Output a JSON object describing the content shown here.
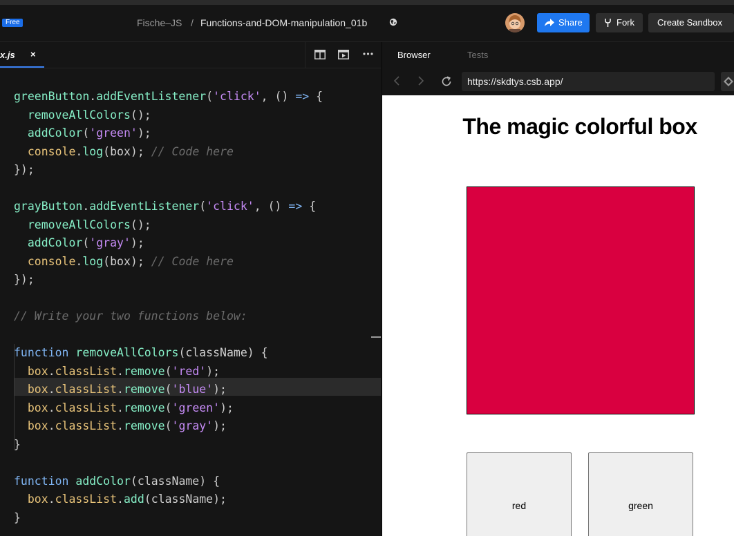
{
  "topbar": {
    "plan_badge": "Free",
    "owner": "Fische–JS",
    "separator": "/",
    "sandbox_name": "Functions-and-DOM-manipulation_01b",
    "share_label": "Share",
    "fork_label": "Fork",
    "create_label": "Create Sandbox"
  },
  "editor": {
    "active_tab": "x.js",
    "close_glyph": "×",
    "code_lines": [
      [
        [
          "fn",
          "greenButton"
        ],
        [
          "p",
          "."
        ],
        [
          "fn",
          "addEventListener"
        ],
        [
          "p",
          "("
        ],
        [
          "str",
          "'click'"
        ],
        [
          "p",
          ", () "
        ],
        [
          "kw",
          "=>"
        ],
        [
          "p",
          " {"
        ]
      ],
      [
        [
          "p",
          "  "
        ],
        [
          "fn",
          "removeAllColors"
        ],
        [
          "p",
          "();"
        ]
      ],
      [
        [
          "p",
          "  "
        ],
        [
          "fn",
          "addColor"
        ],
        [
          "p",
          "("
        ],
        [
          "str",
          "'green'"
        ],
        [
          "p",
          ");"
        ]
      ],
      [
        [
          "p",
          "  "
        ],
        [
          "pr",
          "console"
        ],
        [
          "p",
          "."
        ],
        [
          "fn",
          "log"
        ],
        [
          "p",
          "(box); "
        ],
        [
          "cm",
          "// Code here"
        ]
      ],
      [
        [
          "p",
          "});"
        ]
      ],
      [],
      [
        [
          "fn",
          "grayButton"
        ],
        [
          "p",
          "."
        ],
        [
          "fn",
          "addEventListener"
        ],
        [
          "p",
          "("
        ],
        [
          "str",
          "'click'"
        ],
        [
          "p",
          ", () "
        ],
        [
          "kw",
          "=>"
        ],
        [
          "p",
          " {"
        ]
      ],
      [
        [
          "p",
          "  "
        ],
        [
          "fn",
          "removeAllColors"
        ],
        [
          "p",
          "();"
        ]
      ],
      [
        [
          "p",
          "  "
        ],
        [
          "fn",
          "addColor"
        ],
        [
          "p",
          "("
        ],
        [
          "str",
          "'gray'"
        ],
        [
          "p",
          ");"
        ]
      ],
      [
        [
          "p",
          "  "
        ],
        [
          "pr",
          "console"
        ],
        [
          "p",
          "."
        ],
        [
          "fn",
          "log"
        ],
        [
          "p",
          "(box); "
        ],
        [
          "cm",
          "// Code here"
        ]
      ],
      [
        [
          "p",
          "});"
        ]
      ],
      [],
      [
        [
          "cm",
          "// Write your two functions below:"
        ]
      ],
      [],
      [
        [
          "kw",
          "function"
        ],
        [
          "p",
          " "
        ],
        [
          "fn",
          "removeAllColors"
        ],
        [
          "p",
          "(className) {"
        ]
      ],
      [
        [
          "p",
          "  "
        ],
        [
          "pr",
          "box"
        ],
        [
          "p",
          "."
        ],
        [
          "pr",
          "classList"
        ],
        [
          "p",
          "."
        ],
        [
          "fn",
          "remove"
        ],
        [
          "p",
          "("
        ],
        [
          "str",
          "'red'"
        ],
        [
          "p",
          ");"
        ]
      ],
      [
        [
          "p",
          "  "
        ],
        [
          "pr",
          "box"
        ],
        [
          "p",
          "."
        ],
        [
          "pr",
          "classList"
        ],
        [
          "p",
          "."
        ],
        [
          "fn",
          "remove"
        ],
        [
          "p",
          "("
        ],
        [
          "str",
          "'blue'"
        ],
        [
          "p",
          ");"
        ]
      ],
      [
        [
          "p",
          "  "
        ],
        [
          "pr",
          "box"
        ],
        [
          "p",
          "."
        ],
        [
          "pr",
          "classList"
        ],
        [
          "p",
          "."
        ],
        [
          "fn",
          "remove"
        ],
        [
          "p",
          "("
        ],
        [
          "str",
          "'green'"
        ],
        [
          "p",
          ");"
        ]
      ],
      [
        [
          "p",
          "  "
        ],
        [
          "pr",
          "box"
        ],
        [
          "p",
          "."
        ],
        [
          "pr",
          "classList"
        ],
        [
          "p",
          "."
        ],
        [
          "fn",
          "remove"
        ],
        [
          "p",
          "("
        ],
        [
          "str",
          "'gray'"
        ],
        [
          "p",
          ");"
        ]
      ],
      [
        [
          "p",
          "}"
        ]
      ],
      [],
      [
        [
          "kw",
          "function"
        ],
        [
          "p",
          " "
        ],
        [
          "fn",
          "addColor"
        ],
        [
          "p",
          "(className) {"
        ]
      ],
      [
        [
          "p",
          "  "
        ],
        [
          "pr",
          "box"
        ],
        [
          "p",
          "."
        ],
        [
          "pr",
          "classList"
        ],
        [
          "p",
          "."
        ],
        [
          "fn",
          "add"
        ],
        [
          "p",
          "(className);"
        ]
      ],
      [
        [
          "p",
          "}"
        ]
      ]
    ]
  },
  "browser": {
    "tab_browser": "Browser",
    "tab_tests": "Tests",
    "url": "https://skdtys.csb.app/",
    "page_title": "The magic colorful box",
    "box_color": "#d90040",
    "button_red": "red",
    "button_green": "green"
  }
}
